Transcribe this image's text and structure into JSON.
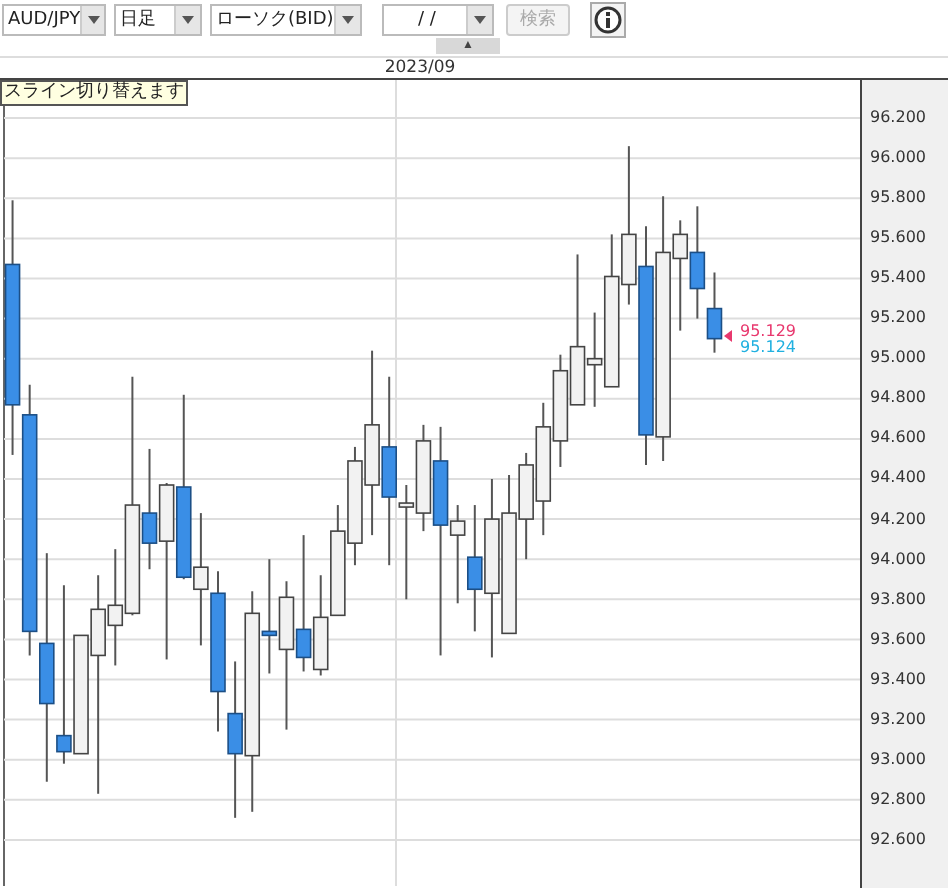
{
  "toolbar": {
    "pair": {
      "value": "AUD/JPY"
    },
    "timeframe": {
      "value": "日足"
    },
    "chart_type": {
      "value": "ローソク(BID)"
    },
    "date": {
      "value": "/  /"
    },
    "search_button": {
      "label": "検索",
      "disabled": true
    }
  },
  "collapse_tab": {
    "label": "▲"
  },
  "chart": {
    "date_label": "2023/09",
    "tooltip": "スライン切り替えます",
    "chart_data": {
      "type": "candlestick",
      "categories": [
        null,
        null,
        null,
        null,
        null,
        null,
        null,
        null,
        null,
        null,
        null,
        null,
        null,
        null,
        null,
        null,
        null,
        null,
        null,
        null,
        null,
        null,
        null,
        null,
        null,
        null,
        null,
        null,
        null,
        null,
        null,
        null,
        null,
        null,
        null,
        null,
        null,
        null,
        null,
        null,
        null,
        null,
        null,
        null,
        null,
        null,
        null,
        null,
        null,
        null
      ],
      "ohlc": [
        [
          95.47,
          95.79,
          94.52,
          94.77
        ],
        [
          94.72,
          94.87,
          93.52,
          93.64
        ],
        [
          93.58,
          94.03,
          92.89,
          93.28
        ],
        [
          93.12,
          93.87,
          92.98,
          93.04
        ],
        [
          93.03,
          93.62,
          93.03,
          93.62
        ],
        [
          93.52,
          93.92,
          92.83,
          93.75
        ],
        [
          93.67,
          94.05,
          93.47,
          93.77
        ],
        [
          93.73,
          94.91,
          93.72,
          94.27
        ],
        [
          94.23,
          94.55,
          93.95,
          94.08
        ],
        [
          94.09,
          94.38,
          93.5,
          94.37
        ],
        [
          94.36,
          94.82,
          93.9,
          93.91
        ],
        [
          93.85,
          94.23,
          93.57,
          93.96
        ],
        [
          93.83,
          93.94,
          93.14,
          93.34
        ],
        [
          93.23,
          93.49,
          92.71,
          93.03
        ],
        [
          93.02,
          93.84,
          92.74,
          93.73
        ],
        [
          93.64,
          94.0,
          93.43,
          93.62
        ],
        [
          93.55,
          93.89,
          93.15,
          93.81
        ],
        [
          93.65,
          94.12,
          93.44,
          93.51
        ],
        [
          93.45,
          93.92,
          93.42,
          93.71
        ],
        [
          93.72,
          94.27,
          93.72,
          94.14
        ],
        [
          94.08,
          94.56,
          93.97,
          94.49
        ],
        [
          94.37,
          95.04,
          94.12,
          94.67
        ],
        [
          94.56,
          94.91,
          93.97,
          94.31
        ],
        [
          94.26,
          94.37,
          93.8,
          94.28
        ],
        [
          94.23,
          94.67,
          94.14,
          94.59
        ],
        [
          94.49,
          94.66,
          93.52,
          94.17
        ],
        [
          94.12,
          94.27,
          93.78,
          94.19
        ],
        [
          94.01,
          94.27,
          93.64,
          93.85
        ],
        [
          93.83,
          94.4,
          93.51,
          94.2
        ],
        [
          93.63,
          94.42,
          93.63,
          94.23
        ],
        [
          94.2,
          94.53,
          94.0,
          94.47
        ],
        [
          94.29,
          94.78,
          94.12,
          94.66
        ],
        [
          94.59,
          95.02,
          94.46,
          94.94
        ],
        [
          94.77,
          95.52,
          94.77,
          95.06
        ],
        [
          94.97,
          95.23,
          94.76,
          95.0
        ],
        [
          94.86,
          95.62,
          94.86,
          95.41
        ],
        [
          95.37,
          96.06,
          95.27,
          95.62
        ],
        [
          95.46,
          95.66,
          94.47,
          94.62
        ],
        [
          94.61,
          95.81,
          94.49,
          95.53
        ],
        [
          95.5,
          95.69,
          95.14,
          95.62
        ],
        [
          95.53,
          95.76,
          95.2,
          95.35
        ],
        [
          95.25,
          95.43,
          95.03,
          95.1
        ],
        null,
        null,
        null,
        null,
        null,
        null,
        null,
        null
      ],
      "grid": true,
      "ylim": [
        92.37,
        96.39
      ],
      "yticks": [
        {
          "value": 96.2,
          "label": "96.200"
        },
        {
          "value": 96.0,
          "label": "96.000"
        },
        {
          "value": 95.8,
          "label": "95.800"
        },
        {
          "value": 95.6,
          "label": "95.600"
        },
        {
          "value": 95.4,
          "label": "95.400"
        },
        {
          "value": 95.2,
          "label": "95.200"
        },
        {
          "value": 95.0,
          "label": "95.000"
        },
        {
          "value": 94.8,
          "label": "94.800"
        },
        {
          "value": 94.6,
          "label": "94.600"
        },
        {
          "value": 94.4,
          "label": "94.400"
        },
        {
          "value": 94.2,
          "label": "94.200"
        },
        {
          "value": 94.0,
          "label": "94.000"
        },
        {
          "value": 93.8,
          "label": "93.800"
        },
        {
          "value": 93.6,
          "label": "93.600"
        },
        {
          "value": 93.4,
          "label": "93.400"
        },
        {
          "value": 93.2,
          "label": "93.200"
        },
        {
          "value": 93.0,
          "label": "93.000"
        },
        {
          "value": 92.8,
          "label": "92.800"
        },
        {
          "value": 92.6,
          "label": "92.600"
        }
      ]
    },
    "bid_label": "95.129",
    "ask_label": "95.124"
  }
}
